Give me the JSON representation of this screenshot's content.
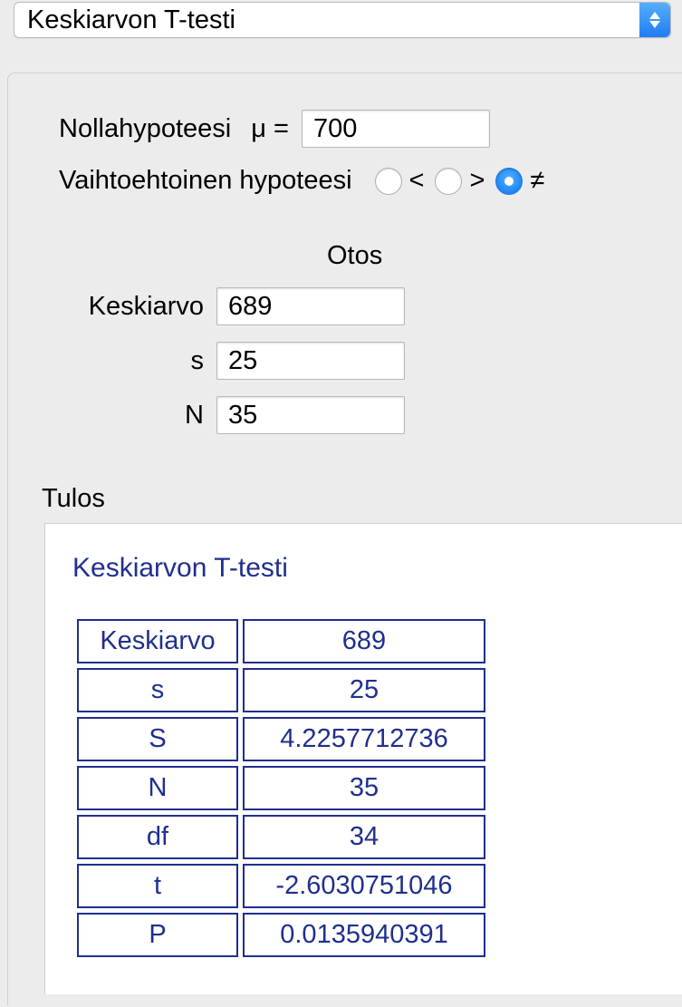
{
  "dropdown": {
    "selected": "Keskiarvon T-testi"
  },
  "null_hyp": {
    "label": "Nollahypoteesi",
    "mu_symbol": "μ =",
    "value": "700"
  },
  "alt_hyp": {
    "label": "Vaihtoehtoinen hypoteesi",
    "options": {
      "lt": "<",
      "gt": ">",
      "ne": "≠"
    },
    "selected": "ne"
  },
  "sample": {
    "title": "Otos",
    "labels": {
      "mean": "Keskiarvo",
      "s": "s",
      "N": "N"
    },
    "values": {
      "mean": "689",
      "s": "25",
      "N": "35"
    }
  },
  "result": {
    "section_label": "Tulos",
    "title": "Keskiarvon T-testi",
    "rows": [
      {
        "k": "Keskiarvo",
        "v": "689"
      },
      {
        "k": "s",
        "v": "25"
      },
      {
        "k": "S",
        "v": "4.2257712736"
      },
      {
        "k": "N",
        "v": "35"
      },
      {
        "k": "df",
        "v": "34"
      },
      {
        "k": "t",
        "v": "-2.6030751046"
      },
      {
        "k": "P",
        "v": "0.0135940391"
      }
    ]
  }
}
